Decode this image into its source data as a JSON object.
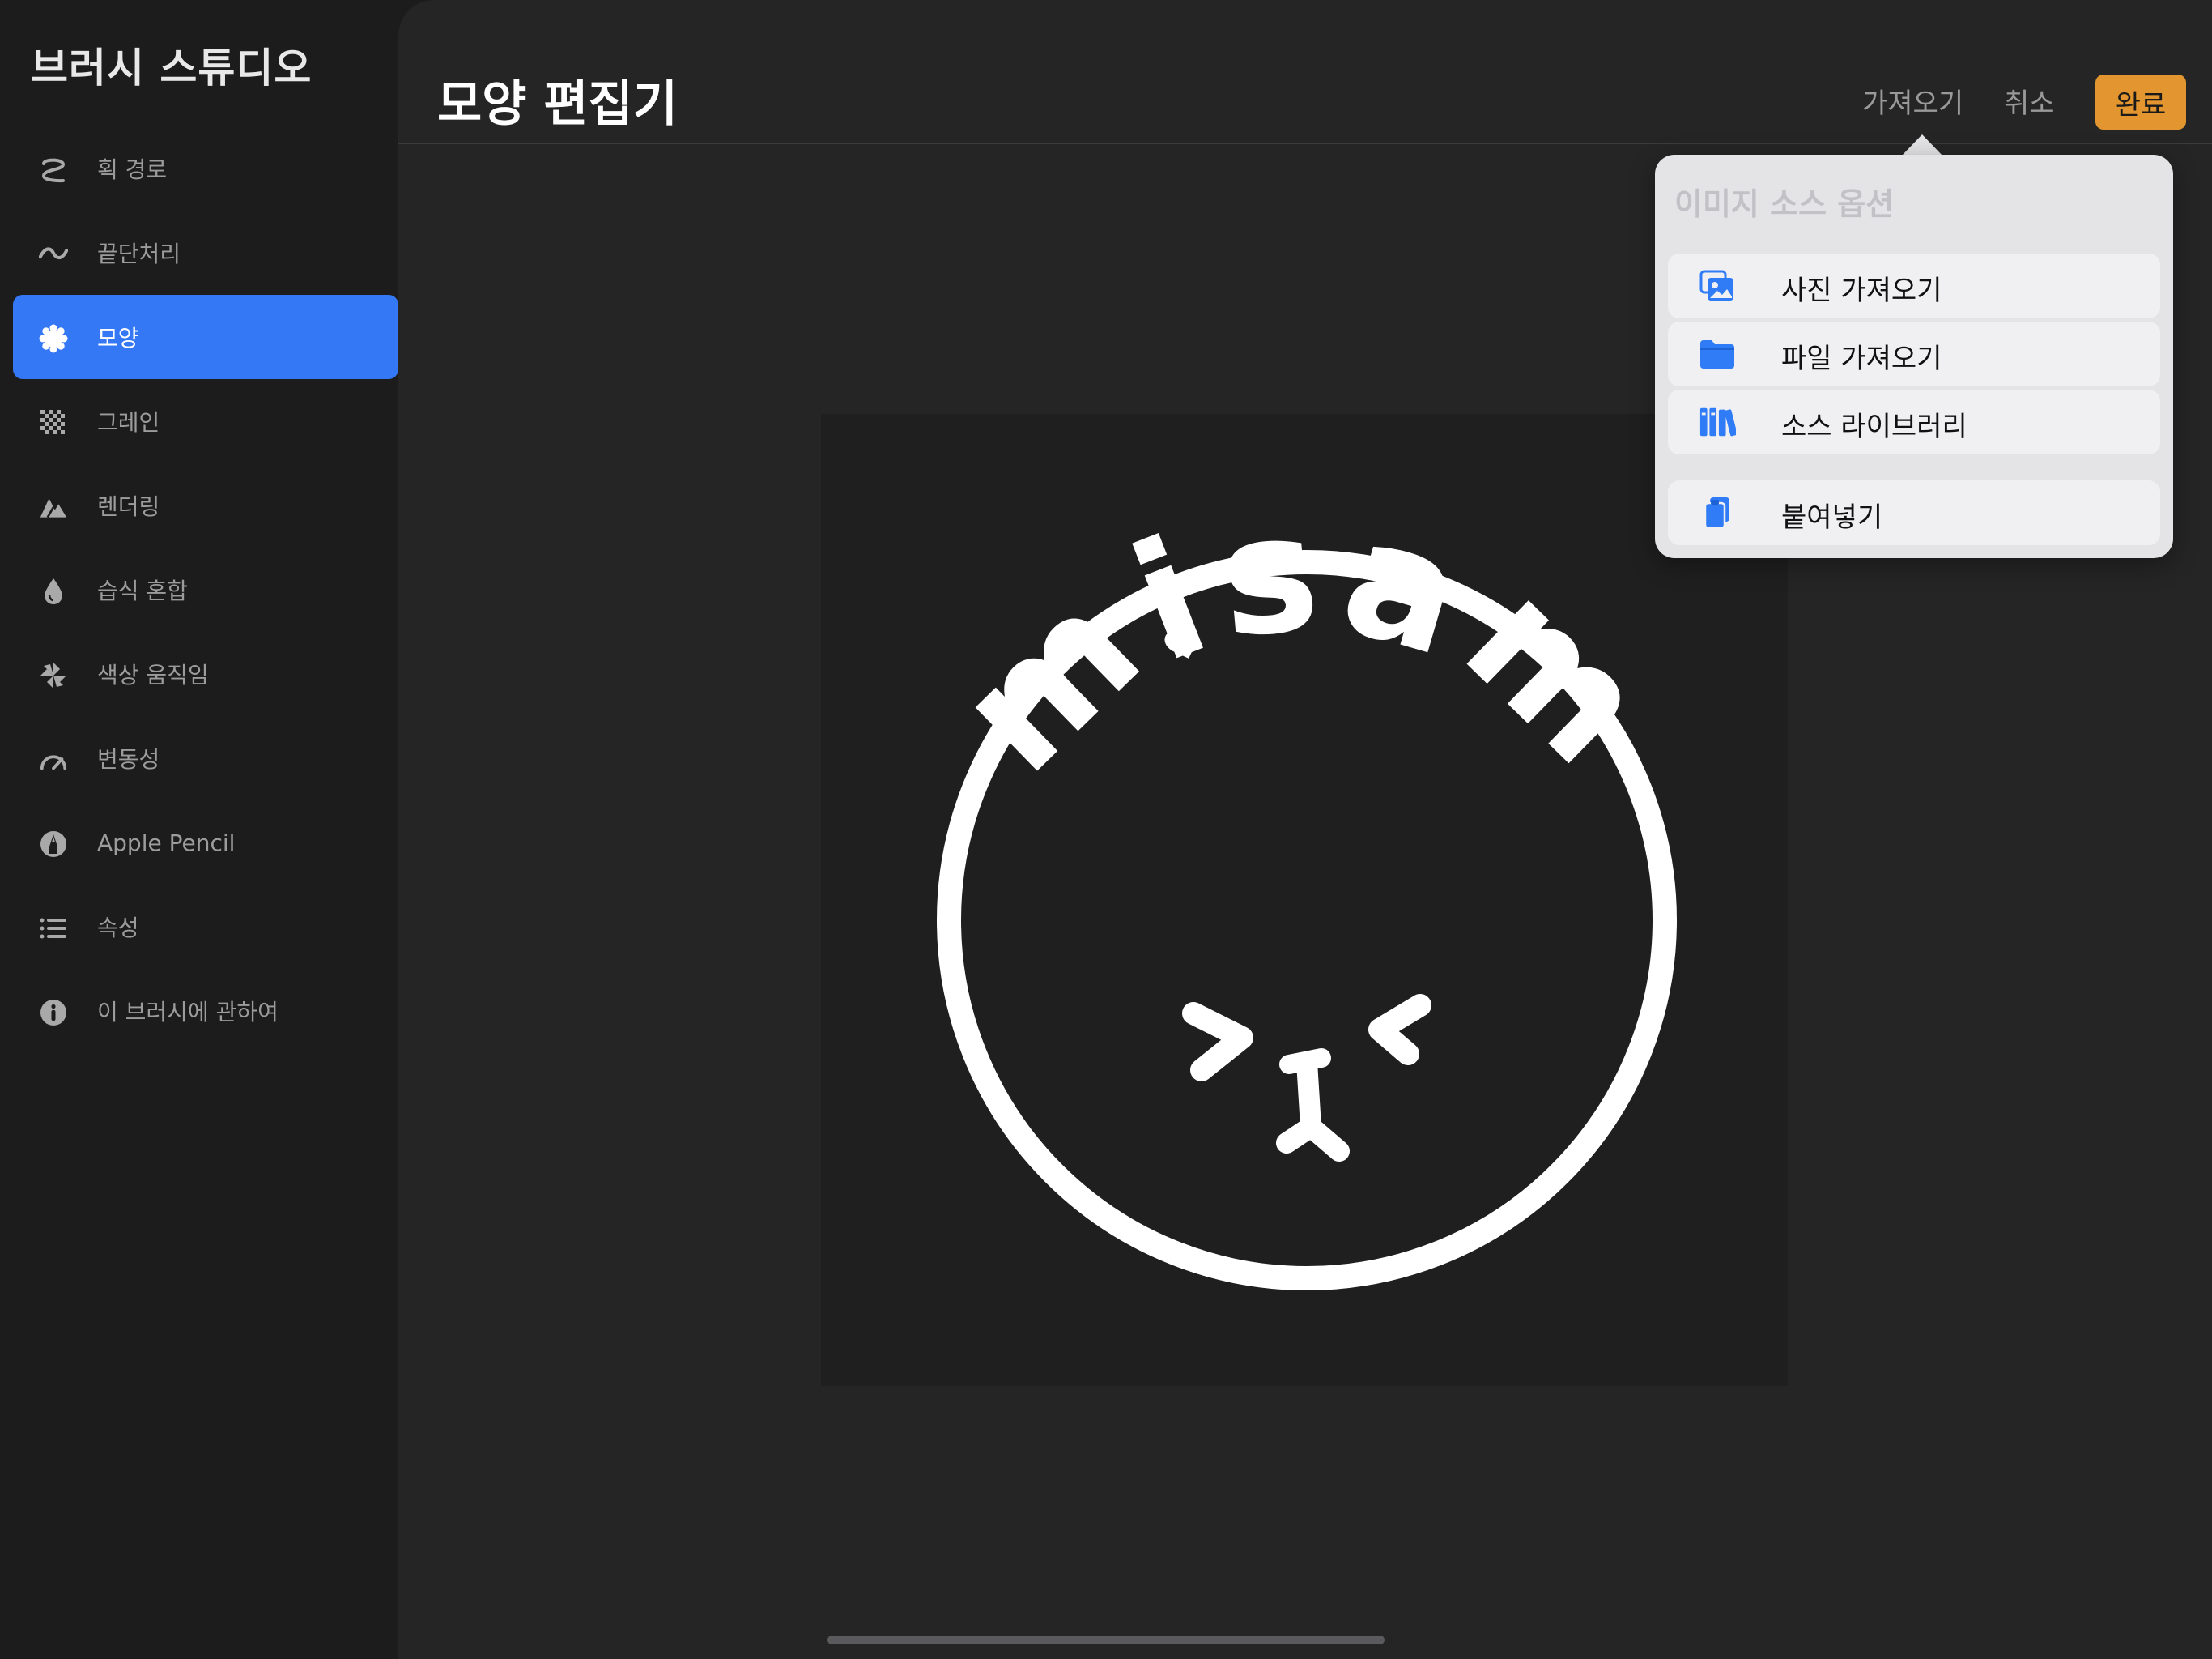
{
  "sidebar": {
    "title": "브러시 스튜디오",
    "items": [
      {
        "label": "획 경로",
        "icon": "stroke-path-icon"
      },
      {
        "label": "끝단처리",
        "icon": "taper-wave-icon"
      },
      {
        "label": "모양",
        "icon": "shape-gear-icon",
        "active": true
      },
      {
        "label": "그레인",
        "icon": "grain-checker-icon"
      },
      {
        "label": "렌더링",
        "icon": "rendering-mountain-icon"
      },
      {
        "label": "습식 혼합",
        "icon": "wet-drop-icon"
      },
      {
        "label": "색상 움직임",
        "icon": "color-pinwheel-icon"
      },
      {
        "label": "변동성",
        "icon": "dynamics-gauge-icon"
      },
      {
        "label": "Apple Pencil",
        "icon": "apple-pencil-icon"
      },
      {
        "label": "속성",
        "icon": "properties-list-icon"
      },
      {
        "label": "이 브러시에 관하여",
        "icon": "info-icon"
      }
    ]
  },
  "header": {
    "title": "모양 편집기",
    "import_label": "가져오기",
    "cancel_label": "취소",
    "done_label": "완료"
  },
  "popover": {
    "title": "이미지 소스 옵션",
    "items": [
      {
        "label": "사진 가져오기",
        "icon": "photo-import-icon"
      },
      {
        "label": "파일 가져오기",
        "icon": "folder-icon"
      },
      {
        "label": "소스 라이브러리",
        "icon": "library-books-icon"
      },
      {
        "label": "붙여넣기",
        "icon": "clipboard-paste-icon"
      }
    ]
  },
  "canvas": {
    "stamp_text": "misam"
  },
  "colors": {
    "accent": "#3478f6",
    "done": "#e3962f",
    "icon_blue": "#2f7cf6"
  }
}
